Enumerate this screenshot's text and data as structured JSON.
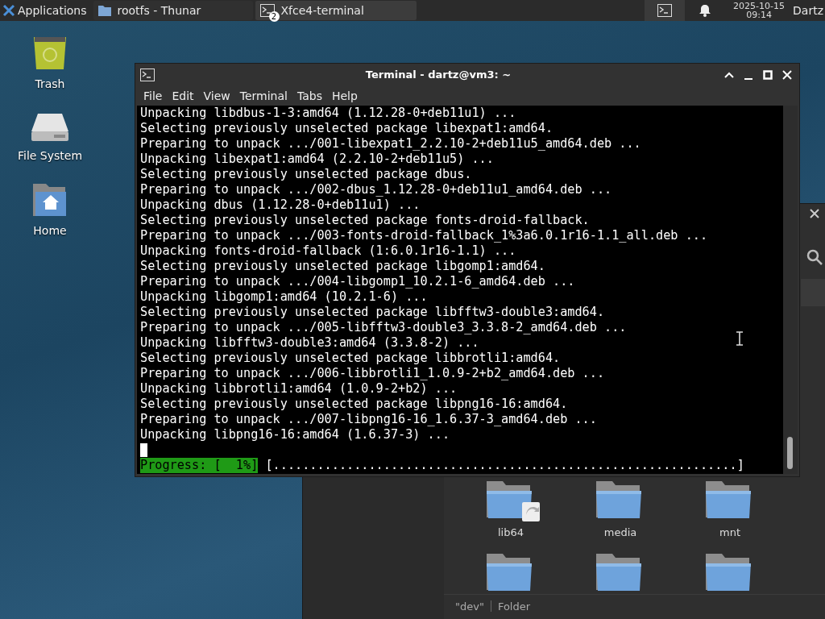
{
  "taskbar": {
    "apps_menu": {
      "label": "Applications"
    },
    "tasks": [
      {
        "label": "rootfs - Thunar",
        "kind": "folder",
        "selected": false
      },
      {
        "label": "Xfce4-terminal",
        "kind": "terminal",
        "badge": "2",
        "selected": true
      }
    ],
    "clock": {
      "date": "2025-10-15",
      "time": "09:14"
    },
    "user": "Dartz"
  },
  "desktop_icons": [
    {
      "label": "Trash",
      "kind": "trash"
    },
    {
      "label": "File System",
      "kind": "drive"
    },
    {
      "label": "Home",
      "kind": "home"
    }
  ],
  "file_manager": {
    "items": [
      {
        "label": "lib64",
        "kind": "link"
      },
      {
        "label": "media",
        "kind": "folder"
      },
      {
        "label": "mnt",
        "kind": "folder"
      },
      {
        "kind": "folder"
      },
      {
        "kind": "folder"
      },
      {
        "kind": "folder"
      }
    ],
    "status": [
      "\"dev\"",
      "Folder"
    ]
  },
  "terminal": {
    "title": "Terminal - dartz@vm3: ~",
    "menu": [
      "File",
      "Edit",
      "View",
      "Terminal",
      "Tabs",
      "Help"
    ],
    "lines": [
      "Unpacking libdbus-1-3:amd64 (1.12.28-0+deb11u1) ...",
      "Selecting previously unselected package libexpat1:amd64.",
      "Preparing to unpack .../001-libexpat1_2.2.10-2+deb11u5_amd64.deb ...",
      "Unpacking libexpat1:amd64 (2.2.10-2+deb11u5) ...",
      "Selecting previously unselected package dbus.",
      "Preparing to unpack .../002-dbus_1.12.28-0+deb11u1_amd64.deb ...",
      "Unpacking dbus (1.12.28-0+deb11u1) ...",
      "Selecting previously unselected package fonts-droid-fallback.",
      "Preparing to unpack .../003-fonts-droid-fallback_1%3a6.0.1r16-1.1_all.deb ...",
      "Unpacking fonts-droid-fallback (1:6.0.1r16-1.1) ...",
      "Selecting previously unselected package libgomp1:amd64.",
      "Preparing to unpack .../004-libgomp1_10.2.1-6_amd64.deb ...",
      "Unpacking libgomp1:amd64 (10.2.1-6) ...",
      "Selecting previously unselected package libfftw3-double3:amd64.",
      "Preparing to unpack .../005-libfftw3-double3_3.3.8-2_amd64.deb ...",
      "Unpacking libfftw3-double3:amd64 (3.3.8-2) ...",
      "Selecting previously unselected package libbrotli1:amd64.",
      "Preparing to unpack .../006-libbrotli1_1.0.9-2+b2_amd64.deb ...",
      "Unpacking libbrotli1:amd64 (1.0.9-2+b2) ...",
      "Selecting previously unselected package libpng16-16:amd64.",
      "Preparing to unpack .../007-libpng16-16_1.6.37-3_amd64.deb ...",
      "Unpacking libpng16-16:amd64 (1.6.37-3) ..."
    ],
    "progress": {
      "label": "Progress: [  1%]",
      "bar": "[...............................................................]"
    }
  }
}
